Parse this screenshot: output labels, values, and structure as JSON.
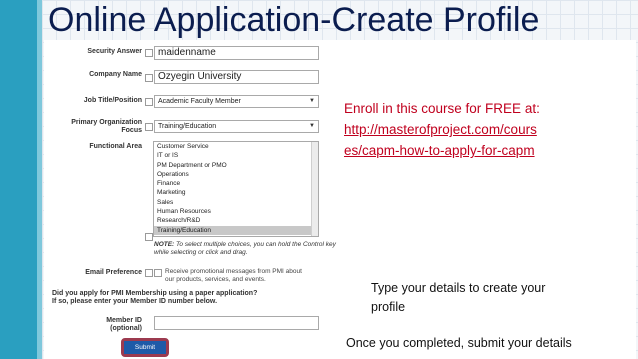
{
  "slide": {
    "title": "Online Application-Create Profile",
    "enroll_text": "Enroll in this course for FREE at:",
    "enroll_url_line1": "http://masterofproject.com/cours",
    "enroll_url_line2": "es/capm-how-to-apply-for-capm",
    "callout_details_line1": "Type your details to create your",
    "callout_details_line2": "profile",
    "callout_submit": "Once you completed, submit your details"
  },
  "form": {
    "security_answer": {
      "label": "Security Answer",
      "value": "maidenname"
    },
    "company_name": {
      "label": "Company Name",
      "value": "Ozyegin University"
    },
    "job_title": {
      "label": "Job Title/Position",
      "value": "Academic Faculty Member"
    },
    "primary_org_focus": {
      "label_line1": "Primary Organization",
      "label_line2": "Focus",
      "value": "Training/Education"
    },
    "functional_area": {
      "label": "Functional Area",
      "options": [
        "Customer Service",
        "IT or IS",
        "PM Department or PMO",
        "Operations",
        "Finance",
        "Marketing",
        "Sales",
        "Human Resources",
        "Research/R&D",
        "Training/Education"
      ],
      "selected": "Training/Education",
      "note_bold": "NOTE:",
      "note_line1": " To select multiple choices, you can hold the Control key",
      "note_line2": "while selecting or click and drag."
    },
    "email_preference": {
      "label": "Email Preference",
      "text_line1": "Receive promotional messages from PMI about",
      "text_line2": "our products, services, and events."
    },
    "membership_question_line1": "Did you apply for PMI Membership using a paper application?",
    "membership_question_line2": "If so, please enter your Member ID number below.",
    "member_id": {
      "label": "Member ID",
      "sublabel": "(optional)",
      "value": ""
    },
    "submit_label": "Submit"
  },
  "colors": {
    "title": "#0b1d4f",
    "accent_bar": "#2a9fc0",
    "enroll_text": "#c0001e",
    "submit_outline": "#9c3a4f",
    "submit_button": "#1e5aa8"
  }
}
